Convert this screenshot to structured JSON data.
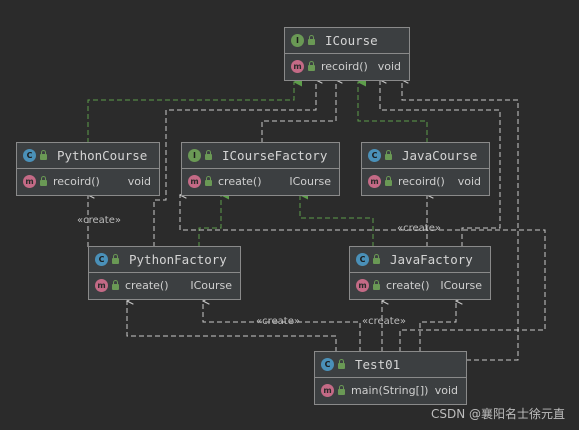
{
  "nodes": {
    "icourse": {
      "title": "ICourse",
      "kind": "interface",
      "badge": "I",
      "members": [
        {
          "name": "recoird()",
          "ret": "void"
        }
      ]
    },
    "pythoncourse": {
      "title": "PythonCourse",
      "kind": "class",
      "badge": "C",
      "members": [
        {
          "name": "recoird()",
          "ret": "void"
        }
      ]
    },
    "icoursefactory": {
      "title": "ICourseFactory",
      "kind": "interface",
      "badge": "I",
      "members": [
        {
          "name": "create()",
          "ret": "ICourse"
        }
      ]
    },
    "javacourse": {
      "title": "JavaCourse",
      "kind": "class",
      "badge": "C",
      "members": [
        {
          "name": "recoird()",
          "ret": "void"
        }
      ]
    },
    "pythonfactory": {
      "title": "PythonFactory",
      "kind": "class",
      "badge": "C",
      "members": [
        {
          "name": "create()",
          "ret": "ICourse"
        }
      ]
    },
    "javafactory": {
      "title": "JavaFactory",
      "kind": "class",
      "badge": "C",
      "members": [
        {
          "name": "create()",
          "ret": "ICourse"
        }
      ]
    },
    "test01": {
      "title": "Test01",
      "kind": "class",
      "badge": "C",
      "members": [
        {
          "name": "main(String[])",
          "ret": "void"
        }
      ]
    }
  },
  "member_badge": "m",
  "labels": {
    "create_python": "«create»",
    "create_java": "«create»",
    "create_test_python": "«create»",
    "create_test_java": "«create»"
  },
  "watermark": "CSDN @襄阳名士徐元直",
  "colors": {
    "background": "#2b2b2b",
    "node_fill": "#3c3f41",
    "realization_edge": "#5e9e4b",
    "dependency_edge": "#c8c8c8",
    "interface_badge": "#6a9955",
    "class_badge": "#4a90b8",
    "method_badge": "#c46a86"
  }
}
